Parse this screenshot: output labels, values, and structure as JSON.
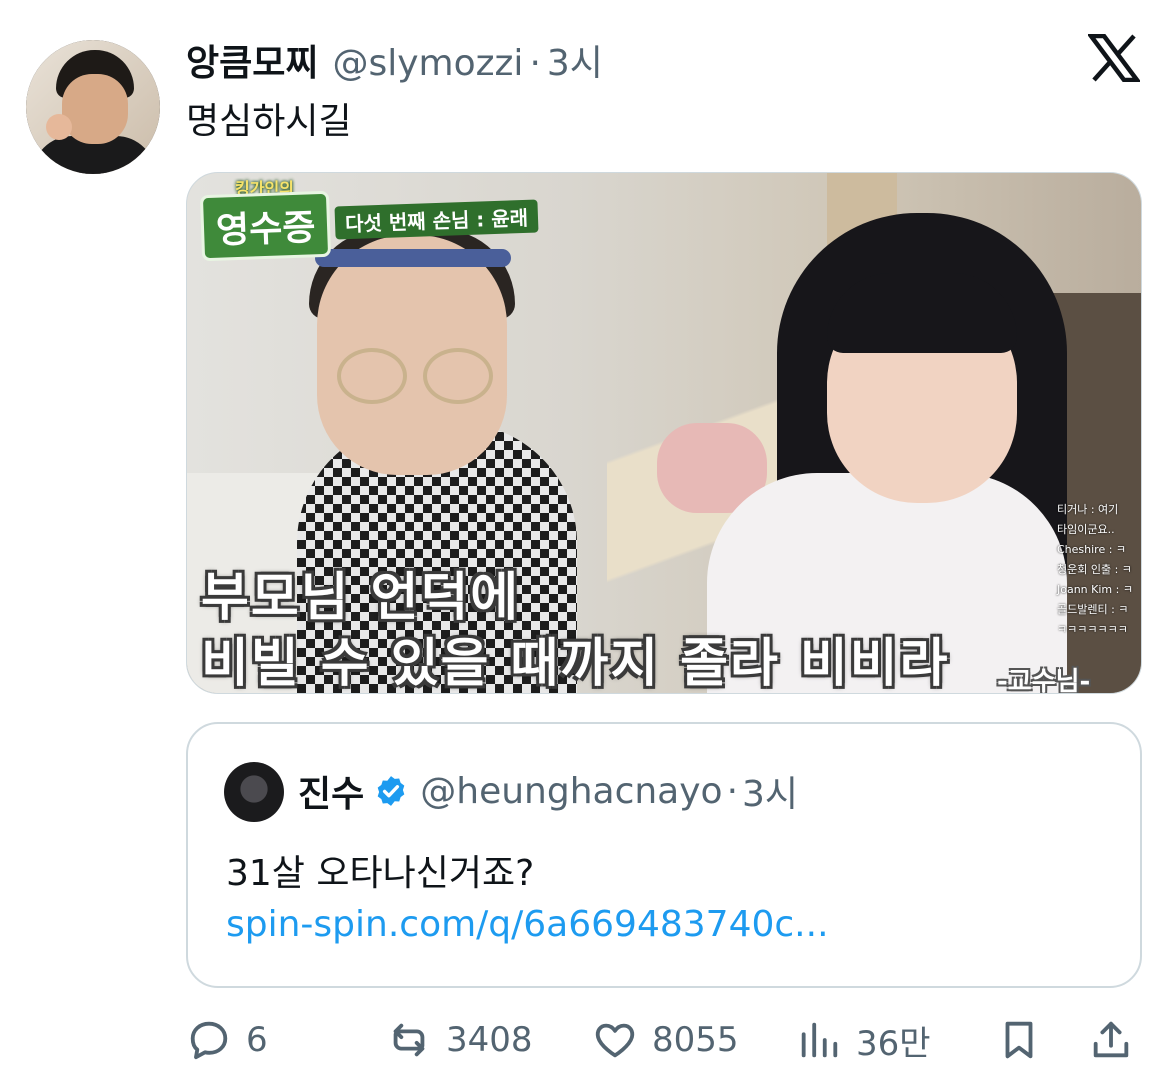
{
  "tweet": {
    "author_name": "앙큼모찌",
    "author_handle": "@slymozzi",
    "separator": "·",
    "time": "3시",
    "text": "명심하시길"
  },
  "media": {
    "badge_small": "킹가인의",
    "badge_main": "영수증",
    "badge_sub": "다섯 번째 손님 : 윤래",
    "caption_line1": "부모님 언덕에",
    "caption_line2": "비빌 수 있을 때까지 졸라 비비라",
    "credit": "-교수님-",
    "chat_lines": [
      "티거나 : 여기",
      "타임이군요..",
      "Cheshire : ㅋ",
      "청운회 인출 : ㅋ",
      "Joann Kim : ㅋ",
      "골드발렌티 : ㅋ",
      "ㅋㅋㅋㅋㅋㅋㅋ"
    ]
  },
  "quote": {
    "author_name": "진수",
    "author_handle": "@heunghacnayo",
    "separator": "·",
    "time": "3시",
    "text": "31살 오타나신거죠?",
    "link": "spin-spin.com/q/6a669483740c..."
  },
  "actions": {
    "replies": "6",
    "retweets": "3408",
    "likes": "8055",
    "views": "36만"
  },
  "colors": {
    "secondary_text": "#536471",
    "link": "#1d9bf0",
    "border": "#cfd9de",
    "verified": "#1d9bf0"
  },
  "icons": [
    "x-logo-icon",
    "verified-icon",
    "reply-icon",
    "retweet-icon",
    "like-icon",
    "views-icon",
    "bookmark-icon",
    "share-icon"
  ]
}
